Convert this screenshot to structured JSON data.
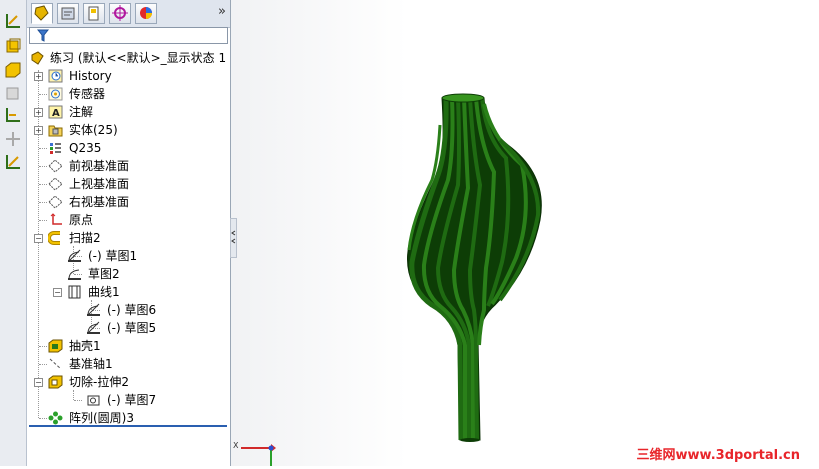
{
  "feature_manager": {
    "root_label": "练习  (默认<<默认>_显示状态 1",
    "items": [
      {
        "label": "History"
      },
      {
        "label": "传感器"
      },
      {
        "label": "注解"
      },
      {
        "label": "实体(25)"
      },
      {
        "label": "Q235"
      },
      {
        "label": "前视基准面"
      },
      {
        "label": "上视基准面"
      },
      {
        "label": "右视基准面"
      },
      {
        "label": "原点"
      },
      {
        "label": "扫描2"
      },
      {
        "label": "(-) 草图1"
      },
      {
        "label": "草图2"
      },
      {
        "label": "曲线1"
      },
      {
        "label": "(-) 草图6"
      },
      {
        "label": "(-) 草图5"
      },
      {
        "label": "抽壳1"
      },
      {
        "label": "基准轴1"
      },
      {
        "label": "切除-拉伸2"
      },
      {
        "label": "(-) 草图7"
      },
      {
        "label": "阵列(圆周)3"
      }
    ],
    "more_tabs_label": "»"
  },
  "triad": {
    "x_label": "X"
  },
  "watermark": "三维网www.3dportal.cn",
  "colors": {
    "model_green": "#1f6b12",
    "model_dark": "#0d3d06",
    "rollback_bar": "#2a5fb0",
    "watermark": "#e8252a"
  }
}
